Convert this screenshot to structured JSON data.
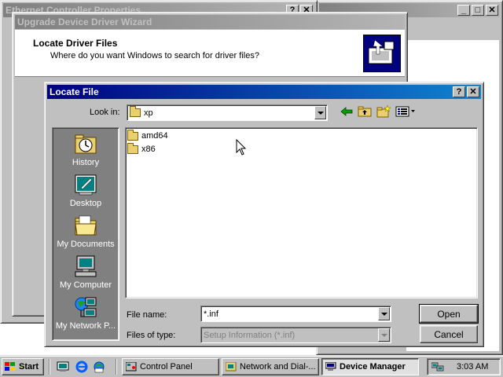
{
  "bg_window": {
    "title": "Ethernet Controller Properties"
  },
  "wizard": {
    "title": "Upgrade Device Driver Wizard",
    "heading": "Locate Driver Files",
    "subheading": "Where do you want Windows to search for driver files?"
  },
  "dialog": {
    "title": "Locate File",
    "help_btn": "?",
    "close_btn": "✕",
    "look_in_label": "Look in:",
    "look_in_value": "xp",
    "files": [
      {
        "name": "amd64",
        "icon": "folder-icon"
      },
      {
        "name": "x86",
        "icon": "folder-icon"
      }
    ],
    "places": [
      {
        "label": "History",
        "icon": "history-icon"
      },
      {
        "label": "Desktop",
        "icon": "desktop-icon"
      },
      {
        "label": "My Documents",
        "icon": "my-documents-icon"
      },
      {
        "label": "My Computer",
        "icon": "my-computer-icon"
      },
      {
        "label": "My Network P...",
        "icon": "network-places-icon"
      }
    ],
    "file_name_label": "File name:",
    "file_name_value": "*.inf",
    "files_of_type_label": "Files of type:",
    "files_of_type_value": "Setup Information (*.inf)",
    "open_label": "Open",
    "cancel_label": "Cancel"
  },
  "taskbar": {
    "start_label": "Start",
    "tasks": [
      {
        "label": "Control Panel",
        "active": false
      },
      {
        "label": "Network and Dial-...",
        "active": false
      },
      {
        "label": "Device Manager",
        "active": true
      }
    ],
    "clock": "3:03 AM"
  },
  "colors": {
    "title_active": "#000080",
    "title_inactive": "#808080",
    "face": "#c0c0c0",
    "places_bar": "#808080"
  }
}
